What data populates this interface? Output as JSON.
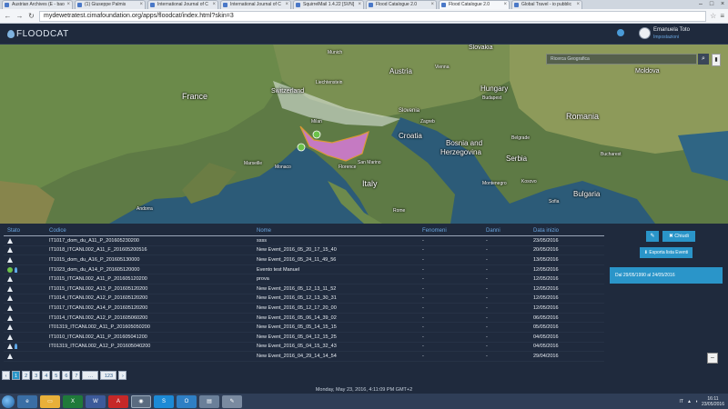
{
  "browser": {
    "tabs": [
      {
        "title": "Austrian Archives (E - bao"
      },
      {
        "title": "(1) Giuseppe Palmis"
      },
      {
        "title": "International Journal of C"
      },
      {
        "title": "International Journal of C"
      },
      {
        "title": "SquirrelMail 1.4.22 [SVN]"
      },
      {
        "title": "Flood Catalogue 2.0"
      },
      {
        "title": "Flood Catalogue 2.0"
      },
      {
        "title": "Global Travel - io pubblic"
      }
    ],
    "url": "mydewetratest.cimafoundation.org/apps/floodcat/index.html?skin=3",
    "window_controls": {
      "minimize": "–",
      "maximize": "□",
      "close": "×"
    }
  },
  "header": {
    "logo_text": "FLOODCAT",
    "user_name": "Emanuela Toto",
    "user_role": "Impostazioni"
  },
  "map": {
    "search_placeholder": "Ricerca Geografica",
    "search_icon": "⌕",
    "layers_icon": "▮",
    "countries": {
      "france": "France",
      "switzerland": "Switzerland",
      "liechtenstein": "Liechtenstein",
      "austria": "Austria",
      "slovakia": "Slovakia",
      "hungary": "Hungary",
      "moldova": "Moldova",
      "romania": "Romania",
      "slovenia": "Slovenia",
      "croatia": "Croatia",
      "bosnia": "Bosnia and",
      "herzegovina": "Herzegovina",
      "serbia": "Serbia",
      "italy": "Italy",
      "monaco": "Monaco",
      "san_marino": "San Marino",
      "bulgaria": "Bulgaria",
      "montenegro": "Montenegro",
      "kosovo": "Kosovo",
      "andorra": "Andorra"
    },
    "cities": {
      "munich": "Munich",
      "milan": "Milan",
      "vienna": "Vienna",
      "budapest": "Budapest",
      "zagreb": "Zagreb",
      "belgrade": "Belgrade",
      "bucharest": "Bucharest",
      "sofia": "Sofia",
      "marseille": "Marseille",
      "rome": "Rome",
      "florence": "Florence"
    }
  },
  "table": {
    "headers": {
      "stato": "Stato",
      "codice": "Codice",
      "nome": "Nome",
      "fenomeni": "Fenomeni",
      "danni": "Danni",
      "data": "Data inizio"
    },
    "rows": [
      {
        "icons": [
          "warn"
        ],
        "codice": "IT1017_dom_du_A11_P_201605230200",
        "nome": "ssss",
        "fenomeni": "-",
        "danni": "-",
        "data": "23/05/2016"
      },
      {
        "icons": [
          "warn"
        ],
        "codice": "IT1018_ITCANL002_A11_F_201605200516",
        "nome": "New Event_2016_05_20_17_15_40",
        "fenomeni": "-",
        "danni": "-",
        "data": "20/05/2016"
      },
      {
        "icons": [
          "warn"
        ],
        "codice": "IT1015_dom_du_A16_P_201605130000",
        "nome": "New Event_2016_05_24_11_49_56",
        "fenomeni": "-",
        "danni": "-",
        "data": "13/05/2016"
      },
      {
        "icons": [
          "ok",
          "pin"
        ],
        "codice": "IT1023_dom_du_A14_P_201605120000",
        "nome": "Evento test Manuel",
        "fenomeni": "-",
        "danni": "-",
        "data": "12/05/2016"
      },
      {
        "icons": [
          "warn"
        ],
        "codice": "IT1015_ITCANL002_A11_P_201605120200",
        "nome": "prova",
        "fenomeni": "-",
        "danni": "-",
        "data": "12/05/2016"
      },
      {
        "icons": [
          "warn"
        ],
        "codice": "IT1015_ITCANL002_A13_P_201605120200",
        "nome": "New Event_2016_05_12_13_11_52",
        "fenomeni": "-",
        "danni": "-",
        "data": "12/05/2016"
      },
      {
        "icons": [
          "warn"
        ],
        "codice": "IT1014_ITCANL002_A12_P_201605120200",
        "nome": "New Event_2016_05_12_13_30_31",
        "fenomeni": "-",
        "danni": "-",
        "data": "12/05/2016"
      },
      {
        "icons": [
          "warn"
        ],
        "codice": "IT1017_ITCANL002_A14_P_201605120200",
        "nome": "New Event_2016_05_12_17_20_00",
        "fenomeni": "-",
        "danni": "-",
        "data": "12/05/2016"
      },
      {
        "icons": [
          "warn"
        ],
        "codice": "IT1014_ITCANL002_A12_P_201605060200",
        "nome": "New Event_2016_05_06_14_39_02",
        "fenomeni": "-",
        "danni": "-",
        "data": "06/05/2016"
      },
      {
        "icons": [
          "warn"
        ],
        "codice": "IT01319_ITCANL002_A11_P_201605050200",
        "nome": "New Event_2016_05_05_14_15_15",
        "fenomeni": "-",
        "danni": "-",
        "data": "05/05/2016"
      },
      {
        "icons": [
          "warn"
        ],
        "codice": "IT1010_ITCANL002_A11_P_201605041200",
        "nome": "New Event_2016_05_04_12_15_25",
        "fenomeni": "-",
        "danni": "-",
        "data": "04/05/2016"
      },
      {
        "icons": [
          "warn",
          "pin"
        ],
        "codice": "IT01319_ITCANL002_A12_P_201605040200",
        "nome": "New Event_2016_05_04_15_32_43",
        "fenomeni": "-",
        "danni": "-",
        "data": "04/05/2016"
      },
      {
        "icons": [
          "warn"
        ],
        "codice": "",
        "nome": "New Event_2016_04_29_14_14_54",
        "fenomeni": "-",
        "danni": "-",
        "data": "29/04/2016"
      }
    ]
  },
  "actions": {
    "edit_icon": "✎",
    "close_label": "✖ Chiudi",
    "export_label": "⬇ Esporta lista Eventi",
    "filter_text": "Dal 29/05/1990 al 24/05/2016",
    "zoom_icon": "–"
  },
  "pagination": {
    "prev": "‹",
    "pages": [
      "1",
      "2",
      "3",
      "4",
      "5",
      "6",
      "7"
    ],
    "ellipsis": "…",
    "last": "123",
    "next": "›",
    "active": "1"
  },
  "status_bar": "Monday, May 23, 2016, 4:11:09 PM GMT+2",
  "taskbar": {
    "clock_time": "16:11",
    "clock_date": "23/05/2016",
    "language": "IT"
  },
  "colors": {
    "accent": "#2a95c9",
    "header_bg": "#1f2a3d",
    "polygon_fill": "#d77bd8",
    "polygon_stroke": "#f0a030",
    "ok_green": "#6cc24a"
  }
}
